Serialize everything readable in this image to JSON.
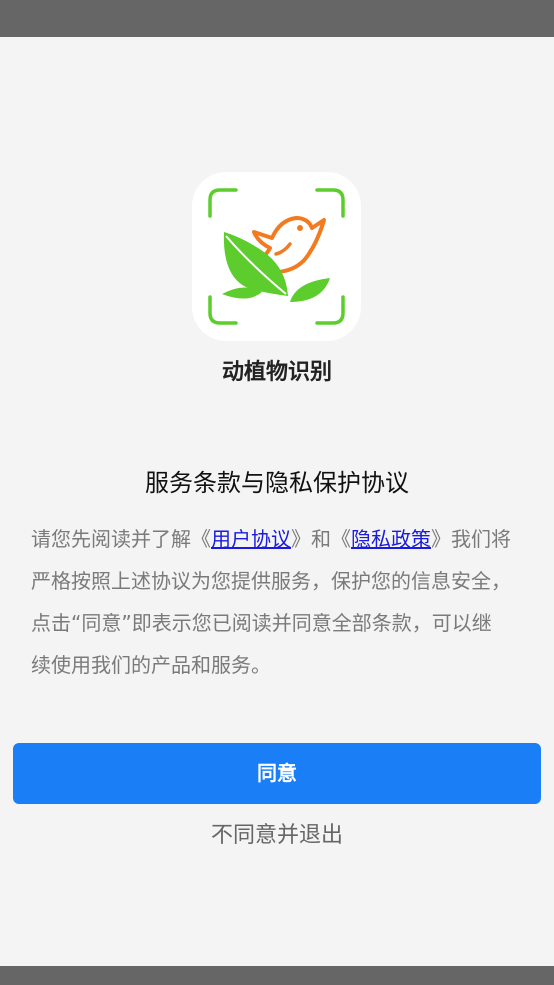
{
  "app": {
    "name": "动植物识别",
    "icon": "bird-leaf-scan-icon"
  },
  "dialog": {
    "title": "服务条款与隐私保护协议",
    "text_before": "请您先阅读并了解《",
    "user_agreement_link": "用户协议",
    "text_middle": "》和《",
    "privacy_policy_link": "隐私政策",
    "text_after": "》我们将严格按照上述协议为您提供服务，保护您的信息安全，点击“同意”即表示您已阅读并同意全部条款，可以继续使用我们的产品和服务。",
    "agree_label": "同意",
    "disagree_label": "不同意并退出"
  },
  "colors": {
    "accent": "#1a7ff7",
    "link": "#1a1ae0",
    "icon_green": "#5ccd2c",
    "icon_orange": "#f47a20"
  }
}
